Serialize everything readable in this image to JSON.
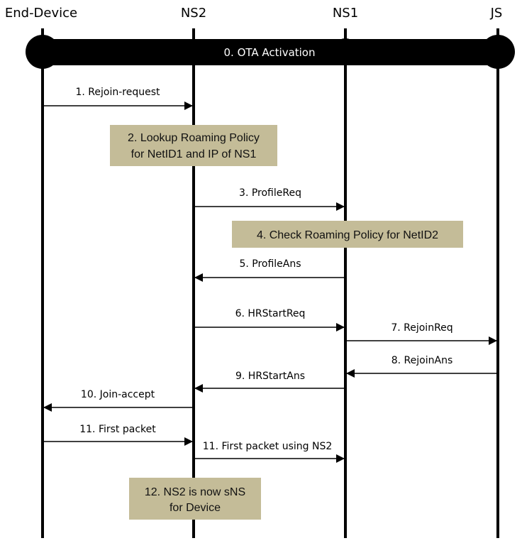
{
  "participants": [
    {
      "id": "ed",
      "label": "End-Device"
    },
    {
      "id": "ns2",
      "label": "NS2"
    },
    {
      "id": "ns1",
      "label": "NS1"
    },
    {
      "id": "js",
      "label": "JS"
    }
  ],
  "activation_bar": {
    "label": "0. OTA Activation",
    "color": "#000000"
  },
  "note_color": "#c4bc98",
  "messages": [
    {
      "label": "1. Rejoin-request",
      "from": "ed",
      "to": "ns2"
    },
    {
      "label": "3. ProfileReq",
      "from": "ns2",
      "to": "ns1"
    },
    {
      "label": "5. ProfileAns",
      "from": "ns1",
      "to": "ns2"
    },
    {
      "label": "6. HRStartReq",
      "from": "ns2",
      "to": "ns1"
    },
    {
      "label": "7. RejoinReq",
      "from": "ns1",
      "to": "js"
    },
    {
      "label": "8. RejoinAns",
      "from": "js",
      "to": "ns1"
    },
    {
      "label": "9. HRStartAns",
      "from": "ns1",
      "to": "ns2"
    },
    {
      "label": "10. Join-accept",
      "from": "ns2",
      "to": "ed"
    },
    {
      "label": "11. First packet",
      "from": "ed",
      "to": "ns2"
    },
    {
      "label": "11. First packet using NS2",
      "from": "ns2",
      "to": "ns1"
    }
  ],
  "notes": [
    {
      "lines": [
        "2. Lookup Roaming Policy",
        "for NetID1 and IP of NS1"
      ]
    },
    {
      "lines": [
        "4. Check Roaming Policy for NetID2"
      ]
    },
    {
      "lines": [
        "12. NS2 is now sNS",
        "for Device"
      ]
    }
  ]
}
